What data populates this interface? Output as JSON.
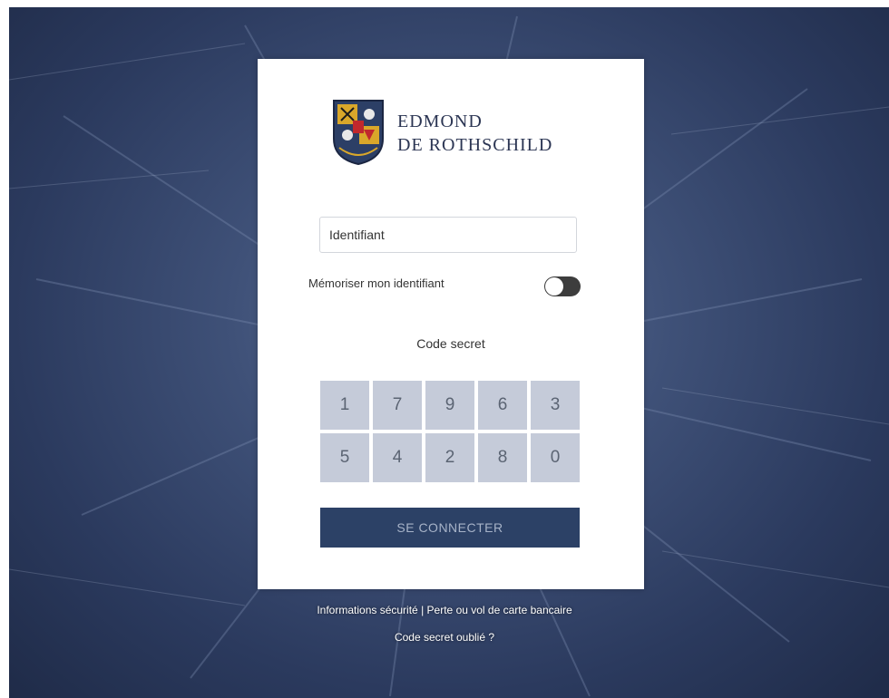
{
  "brand": {
    "line1": "EDMOND",
    "line2": "DE ROTHSCHILD",
    "logo_icon": "coat-of-arms-icon"
  },
  "login": {
    "identifier_placeholder": "Identifiant",
    "remember_label": "Mémoriser mon identifiant",
    "remember_enabled": false,
    "code_label": "Code secret",
    "keypad_digits": [
      "1",
      "7",
      "9",
      "6",
      "3",
      "5",
      "4",
      "2",
      "8",
      "0"
    ],
    "connect_label": "SE CONNECTER"
  },
  "footer": {
    "security_info": "Informations sécurité",
    "separator": "|",
    "card_loss": "Perte ou vol de carte bancaire",
    "forgot_code": "Code secret oublié ?"
  },
  "colors": {
    "keypad_key": "#c5cbd9",
    "connect_button": "#2c4166",
    "brand_text": "#2b3553",
    "background_denim": "#3f5178"
  }
}
